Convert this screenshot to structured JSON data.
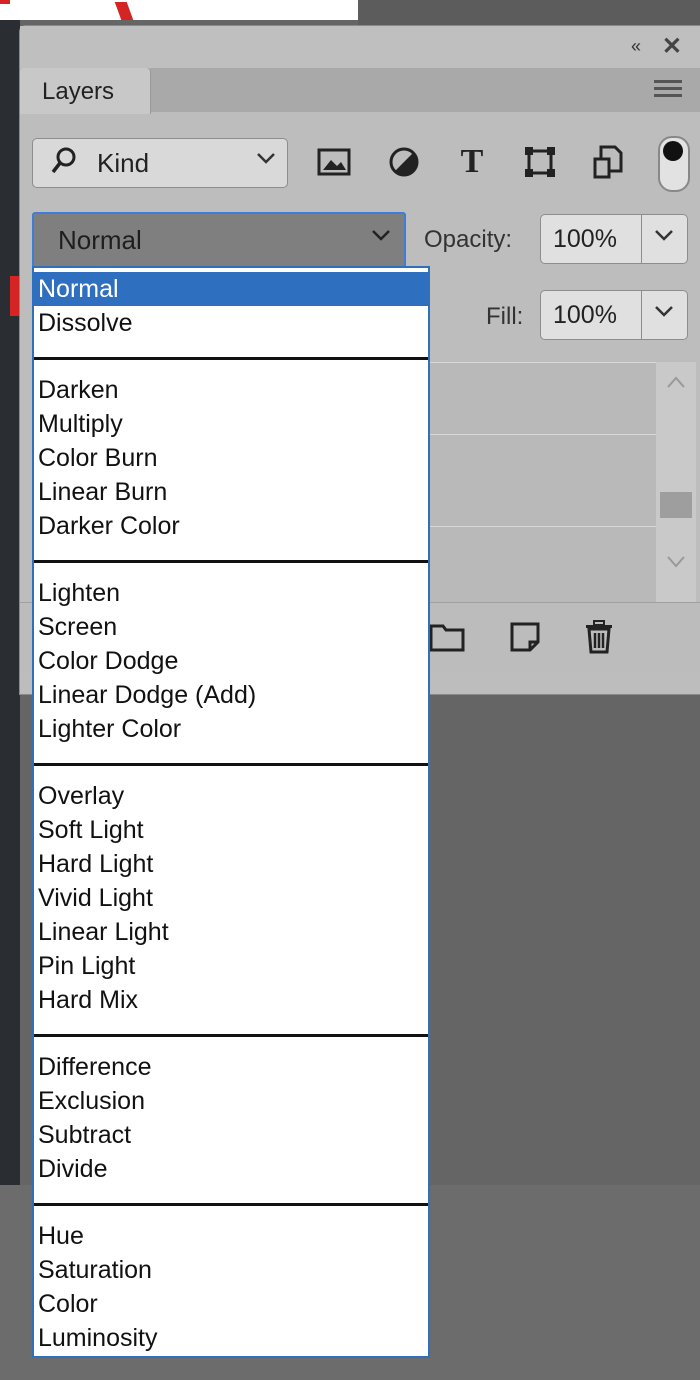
{
  "panel": {
    "tab_label": "Layers",
    "collapse_glyph": "«",
    "close_glyph": "✕"
  },
  "filter": {
    "label": "Kind",
    "icons": [
      "image-filter-icon",
      "adjustment-filter-icon",
      "type-filter-icon",
      "shape-filter-icon",
      "smart-object-filter-icon"
    ]
  },
  "blend_mode": {
    "value": "Normal",
    "options": [
      [
        "Normal",
        "Dissolve"
      ],
      [
        "Darken",
        "Multiply",
        "Color Burn",
        "Linear Burn",
        "Darker Color"
      ],
      [
        "Lighten",
        "Screen",
        "Color Dodge",
        "Linear Dodge (Add)",
        "Lighter Color"
      ],
      [
        "Overlay",
        "Soft Light",
        "Hard Light",
        "Vivid Light",
        "Linear Light",
        "Pin Light",
        "Hard Mix"
      ],
      [
        "Difference",
        "Exclusion",
        "Subtract",
        "Divide"
      ],
      [
        "Hue",
        "Saturation",
        "Color",
        "Luminosity"
      ]
    ],
    "selected": "Normal"
  },
  "opacity": {
    "label": "Opacity:",
    "value": "100%"
  },
  "fill": {
    "label": "Fill:",
    "value": "100%"
  },
  "colors": {
    "accent": "#2f6fbf",
    "panel": "#bdbdbd",
    "background": "#656565"
  }
}
